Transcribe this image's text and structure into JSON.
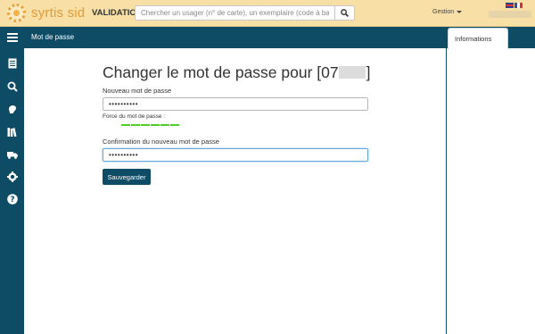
{
  "header": {
    "brand": "syrtis sid",
    "environment": "VALIDATION",
    "search_placeholder": "Chercher un usager (n° de carte), un exemplaire (code à barres)...",
    "menu_gestion": "Gestion",
    "languages": [
      "English",
      "Français"
    ]
  },
  "subheader": {
    "title": "Mot de passe"
  },
  "sidebar": {
    "icons": [
      "catalog-icon",
      "search-icon",
      "user-icon",
      "books-icon",
      "truck-icon",
      "gear-icon",
      "help-icon"
    ]
  },
  "right_panel": {
    "tab_label": "Informations"
  },
  "form": {
    "heading_prefix": "Changer le mot de passe pour [07",
    "heading_suffix": "]",
    "new_password_label": "Nouveau mot de passe",
    "new_password_value": "••••••••••",
    "strength_label": "Force du mot de passe :",
    "strength_segments": 6,
    "strength_filled": 6,
    "strength_color": "#4fce2a",
    "confirm_label": "Confirmation du nouveau mot de passe",
    "confirm_value": "••••••••••",
    "save_label": "Sauvegarder"
  },
  "colors": {
    "header_bg": "#f7dfa6",
    "brand": "#e39a37",
    "nav_bg": "#0e4c66"
  }
}
